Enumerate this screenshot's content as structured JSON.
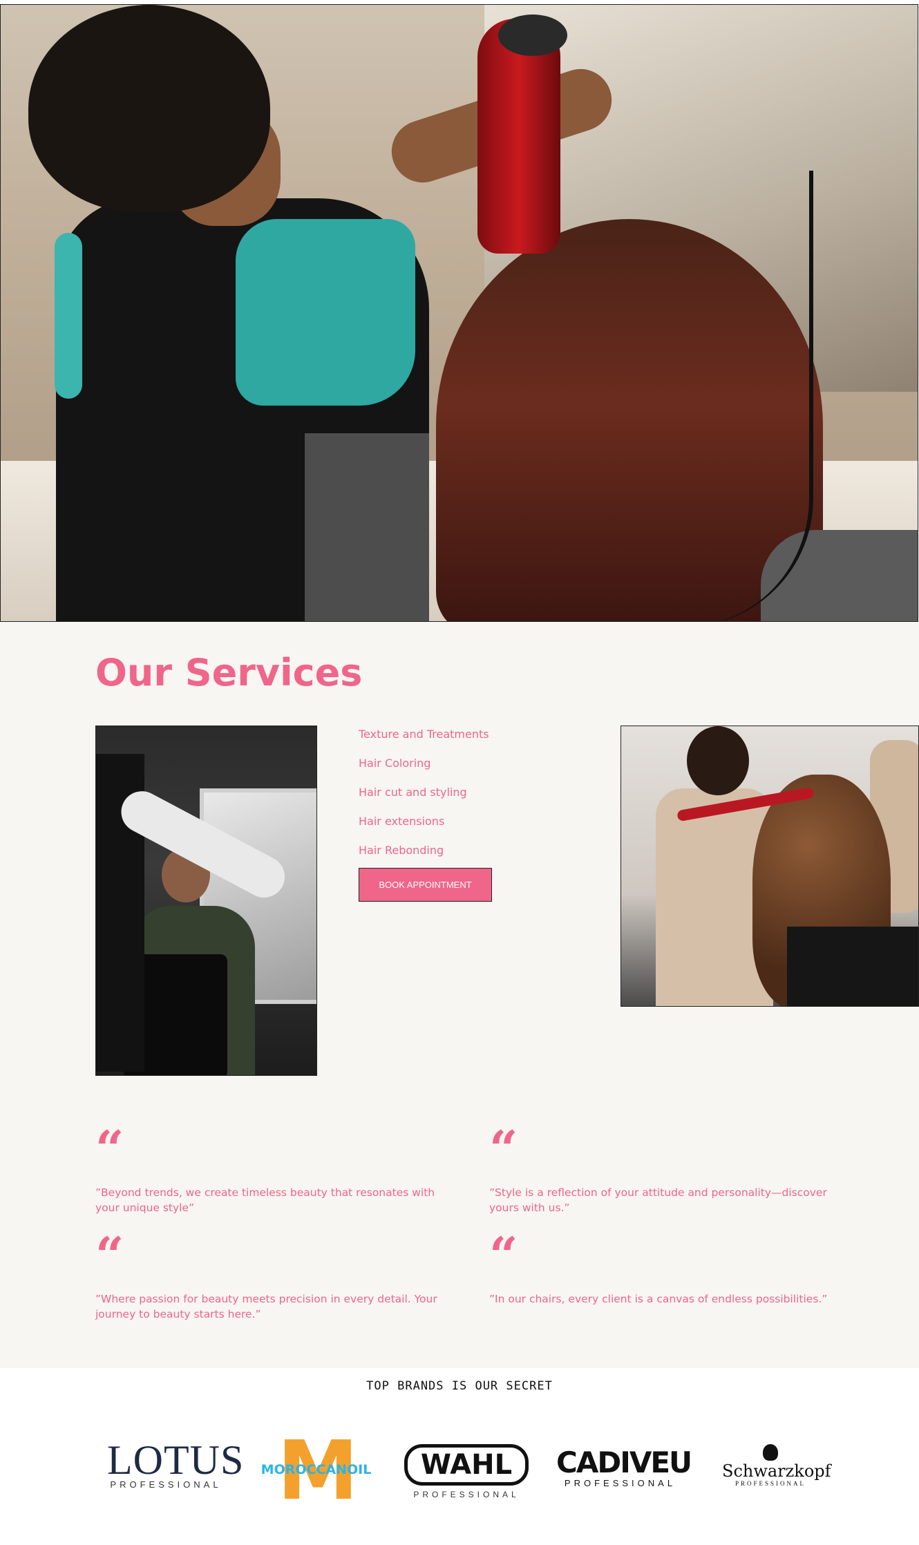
{
  "services": {
    "title": "Our Services",
    "items": [
      "Texture and Treatments",
      "Hair Coloring",
      "Hair cut and styling",
      "Hair extensions",
      "Hair Rebonding"
    ],
    "book_label": "BOOK APPOINTMENT",
    "accent_color": "#f0658a"
  },
  "quotes": [
    {
      "mark": "“",
      "text": "”Beyond trends, we create timeless beauty that resonates with your unique style”"
    },
    {
      "mark": "“",
      "text": "”Style is a reflection of your attitude and personality—discover yours with us.”"
    },
    {
      "mark": "“",
      "text": "”Where passion for beauty meets precision in every detail. Your journey to beauty starts here.”"
    },
    {
      "mark": "“",
      "text": "”In our chairs, every client is a canvas of endless possibilities.”"
    }
  ],
  "brands": {
    "title": "TOP BRANDS IS OUR SECRET",
    "logos": [
      {
        "name": "LOTUS",
        "sub": "PROFESSIONAL"
      },
      {
        "name": "MOROCCANOIL",
        "sub": "M"
      },
      {
        "name": "WAHL",
        "sub": "PROFESSIONAL"
      },
      {
        "name": "CADIVEU",
        "sub": "PROFESSIONAL"
      },
      {
        "name": "Schwarzkopf",
        "sub": "PROFESSIONAL"
      }
    ]
  }
}
